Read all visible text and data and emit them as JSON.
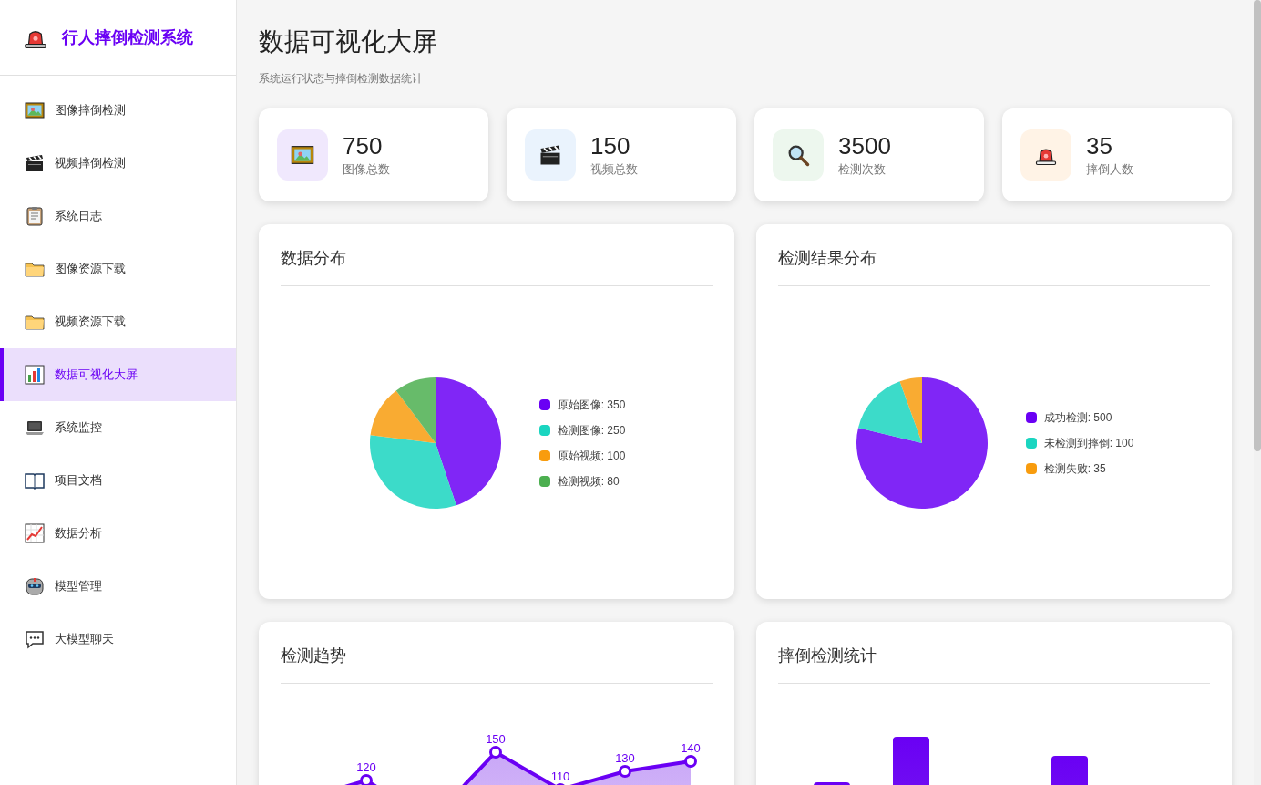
{
  "sidebar": {
    "title": "行人摔倒检测系统",
    "items": [
      {
        "label": "图像摔倒检测",
        "selected": false
      },
      {
        "label": "视频摔倒检测",
        "selected": false
      },
      {
        "label": "系统日志",
        "selected": false
      },
      {
        "label": "图像资源下载",
        "selected": false
      },
      {
        "label": "视频资源下载",
        "selected": false
      },
      {
        "label": "数据可视化大屏",
        "selected": true
      },
      {
        "label": "系统监控",
        "selected": false
      },
      {
        "label": "项目文档",
        "selected": false
      },
      {
        "label": "数据分析",
        "selected": false
      },
      {
        "label": "模型管理",
        "selected": false
      },
      {
        "label": "大模型聊天",
        "selected": false
      }
    ]
  },
  "header": {
    "title": "数据可视化大屏",
    "subtitle": "系统运行状态与摔倒检测数据统计"
  },
  "stats": [
    {
      "value": "750",
      "label": "图像总数",
      "color": "#f0e8fd"
    },
    {
      "value": "150",
      "label": "视频总数",
      "color": "#eaf3fd"
    },
    {
      "value": "3500",
      "label": "检测次数",
      "color": "#edf7ee"
    },
    {
      "value": "35",
      "label": "摔倒人数",
      "color": "#fff3e6"
    }
  ],
  "charts": [
    {
      "title": "数据分布",
      "chart_data": {
        "type": "pie",
        "values": [
          350,
          250,
          100,
          80
        ],
        "colors": [
          "#6a00f4",
          "#1ad5c0",
          "#f89c0e",
          "#4caf50"
        ],
        "categories": [
          "原始图像: 350",
          "检测图像: 250",
          "原始视频: 100",
          "检测视频: 80"
        ],
        "legend": "right"
      }
    },
    {
      "title": "检测结果分布",
      "chart_data": {
        "type": "pie",
        "values": [
          500,
          100,
          35
        ],
        "colors": [
          "#6a00f4",
          "#1ad5c0",
          "#f89c0e"
        ],
        "categories": [
          "成功检测: 500",
          "未检测到摔倒: 100",
          "检测失败: 35"
        ],
        "legend": "right"
      }
    },
    {
      "title": "检测趋势",
      "kind": "line",
      "point_labels": [
        "120",
        "150",
        "110",
        "130",
        "140"
      ]
    },
    {
      "title": "摔倒检测统计",
      "kind": "bar"
    }
  ]
}
